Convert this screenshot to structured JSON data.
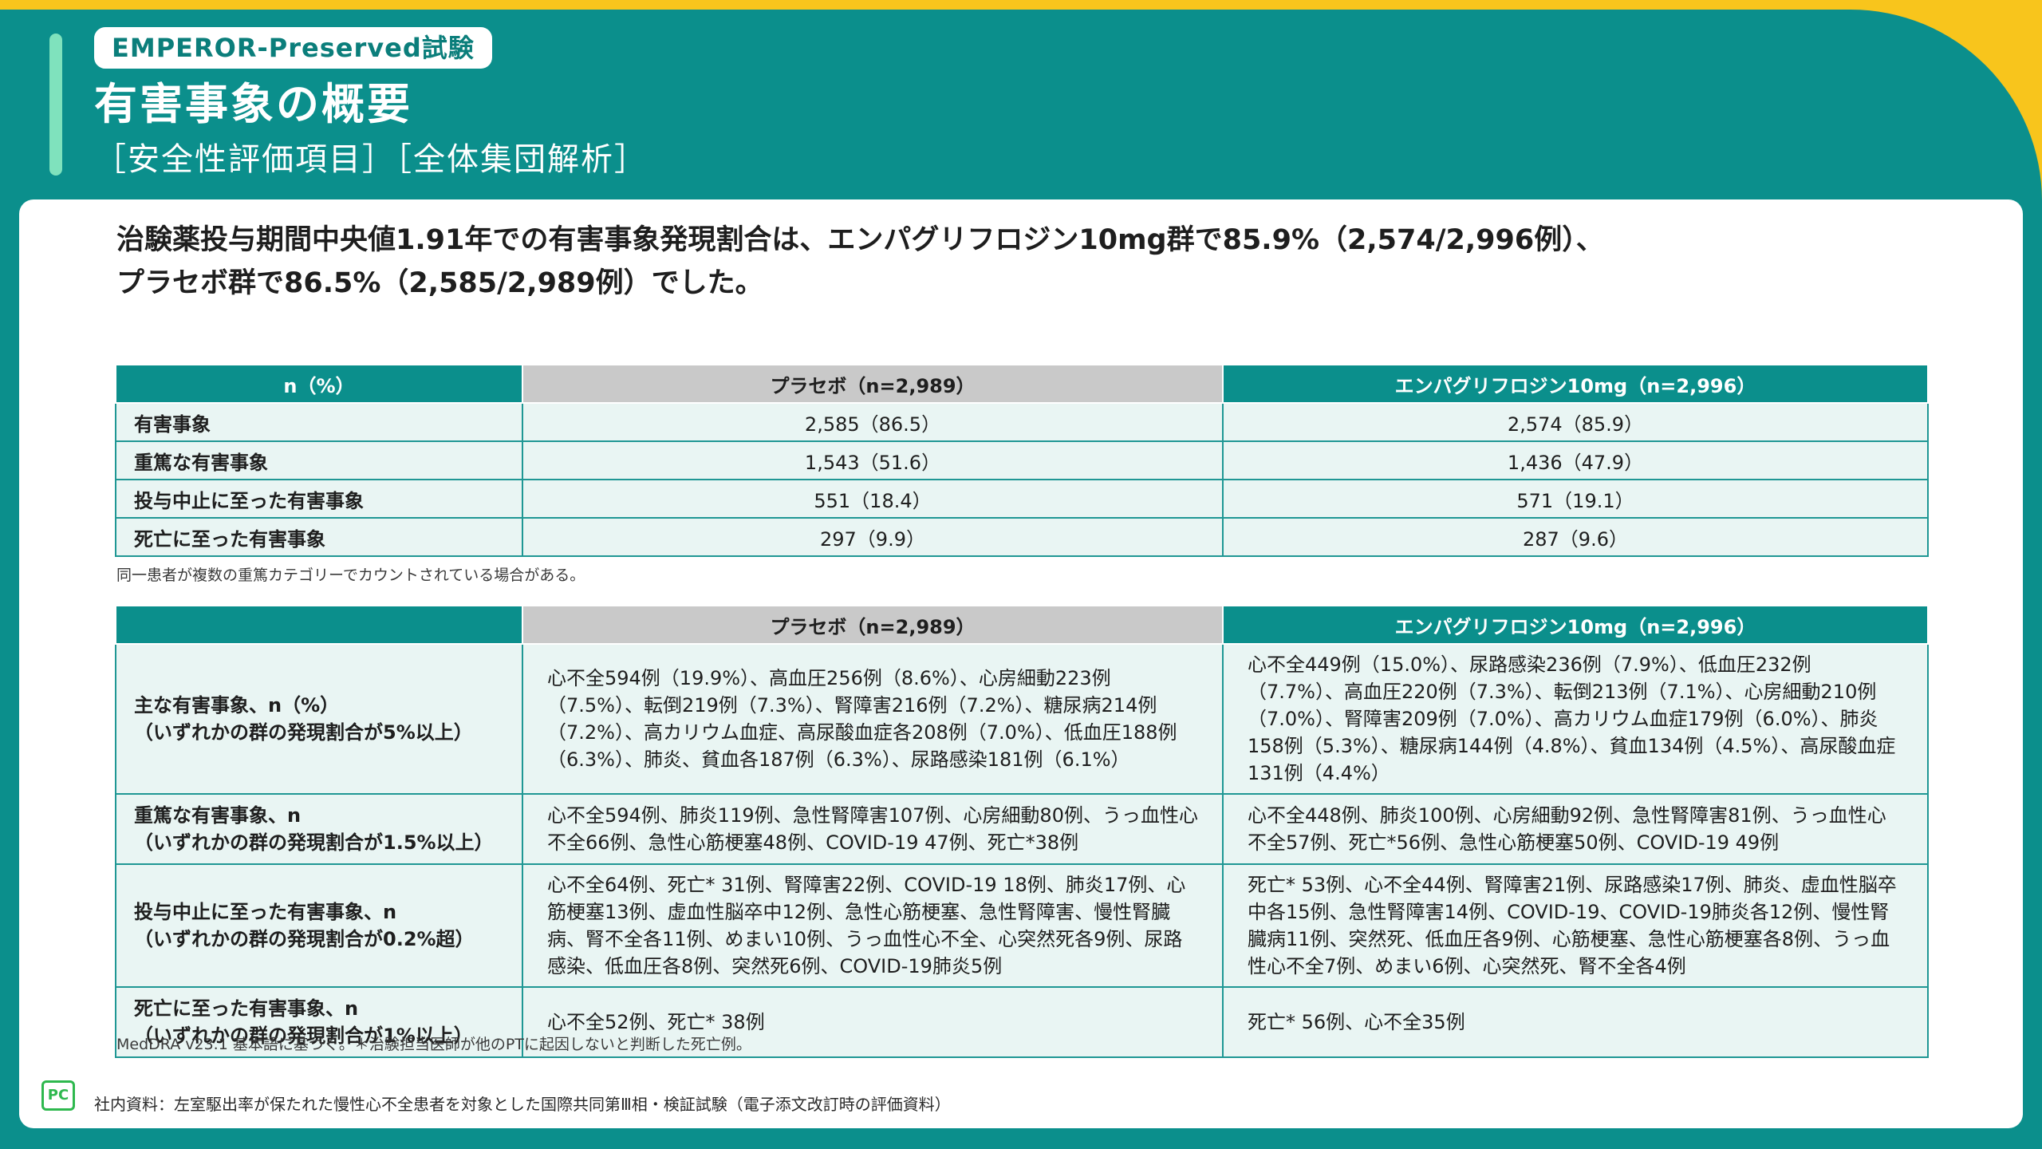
{
  "header": {
    "trial_badge": "EMPEROR-Preserved試験",
    "title": "有害事象の概要",
    "subtitle": "［安全性評価項目］［全体集団解析］"
  },
  "lead": {
    "line1": "治験薬投与期間中央値1.91年での有害事象発現割合は、エンパグリフロジン10mg群で85.9%（2,574/2,996例）、",
    "line2": "プラセボ群で86.5%（2,585/2,989例）でした。"
  },
  "table1": {
    "headers": [
      "n（%）",
      "プラセボ（n=2,989）",
      "エンパグリフロジン10mg（n=2,996）"
    ],
    "rows": [
      {
        "label": "有害事象",
        "placebo": "2,585（86.5）",
        "empa": "2,574（85.9）"
      },
      {
        "label": "重篤な有害事象",
        "placebo": "1,543（51.6）",
        "empa": "1,436（47.9）"
      },
      {
        "label": "投与中止に至った有害事象",
        "placebo": "551（18.4）",
        "empa": "571（19.1）"
      },
      {
        "label": "死亡に至った有害事象",
        "placebo": "297（9.9）",
        "empa": "287（9.6）"
      }
    ],
    "footnote": "同一患者が複数の重篤カテゴリーでカウントされている場合がある。"
  },
  "table2": {
    "headers": [
      "",
      "プラセボ（n=2,989）",
      "エンパグリフロジン10mg（n=2,996）"
    ],
    "rows": [
      {
        "label1": "主な有害事象、n（%）",
        "label2": "（いずれかの群の発現割合が5%以上）",
        "placebo": "心不全594例（19.9%）、高血圧256例（8.6%）、心房細動223例（7.5%）、転倒219例（7.3%）、腎障害216例（7.2%）、糖尿病214例（7.2%）、高カリウム血症、高尿酸血症各208例（7.0%）、低血圧188例（6.3%）、肺炎、貧血各187例（6.3%）、尿路感染181例（6.1%）",
        "empa": "心不全449例（15.0%）、尿路感染236例（7.9%）、低血圧232例（7.7%）、高血圧220例（7.3%）、転倒213例（7.1%）、心房細動210例（7.0%）、腎障害209例（7.0%）、高カリウム血症179例（6.0%）、肺炎158例（5.3%）、糖尿病144例（4.8%）、貧血134例（4.5%）、高尿酸血症131例（4.4%）"
      },
      {
        "label1": "重篤な有害事象、n",
        "label2": "（いずれかの群の発現割合が1.5%以上）",
        "placebo": "心不全594例、肺炎119例、急性腎障害107例、心房細動80例、うっ血性心不全66例、急性心筋梗塞48例、COVID-19 47例、死亡*38例",
        "empa": "心不全448例、肺炎100例、心房細動92例、急性腎障害81例、うっ血性心不全57例、死亡*56例、急性心筋梗塞50例、COVID-19 49例"
      },
      {
        "label1": "投与中止に至った有害事象、n",
        "label2": "（いずれかの群の発現割合が0.2%超）",
        "placebo": "心不全64例、死亡* 31例、腎障害22例、COVID-19 18例、肺炎17例、心筋梗塞13例、虚血性脳卒中12例、急性心筋梗塞、急性腎障害、慢性腎臓病、腎不全各11例、めまい10例、うっ血性心不全、心突然死各9例、尿路感染、低血圧各8例、突然死6例、COVID-19肺炎5例",
        "empa": "死亡* 53例、心不全44例、腎障害21例、尿路感染17例、肺炎、虚血性脳卒中各15例、急性腎障害14例、COVID-19、COVID-19肺炎各12例、慢性腎臓病11例、突然死、低血圧各9例、心筋梗塞、急性心筋梗塞各8例、うっ血性心不全7例、めまい6例、心突然死、腎不全各4例"
      },
      {
        "label1": "死亡に至った有害事象、n",
        "label2": "（いずれかの群の発現割合が1%以上）",
        "placebo": "心不全52例、死亡* 38例",
        "empa": "死亡* 56例、心不全35例"
      }
    ],
    "footnote": "MedDRA v23.1 基本語に基づく。＊治験担当医師が他のPTに起因しないと判断した死亡例。"
  },
  "footer": {
    "logo_text": "PC",
    "source": "社内資料：左室駆出率が保たれた慢性心不全患者を対象とした国際共同第Ⅲ相・検証試験（電子添文改訂時の評価資料）"
  },
  "colors": {
    "teal": "#0b8f8c",
    "yellow": "#f8c51c",
    "mint": "#7fe2bd",
    "row_bg": "#e9f5f3",
    "placebo_header": "#c9c9c9"
  }
}
